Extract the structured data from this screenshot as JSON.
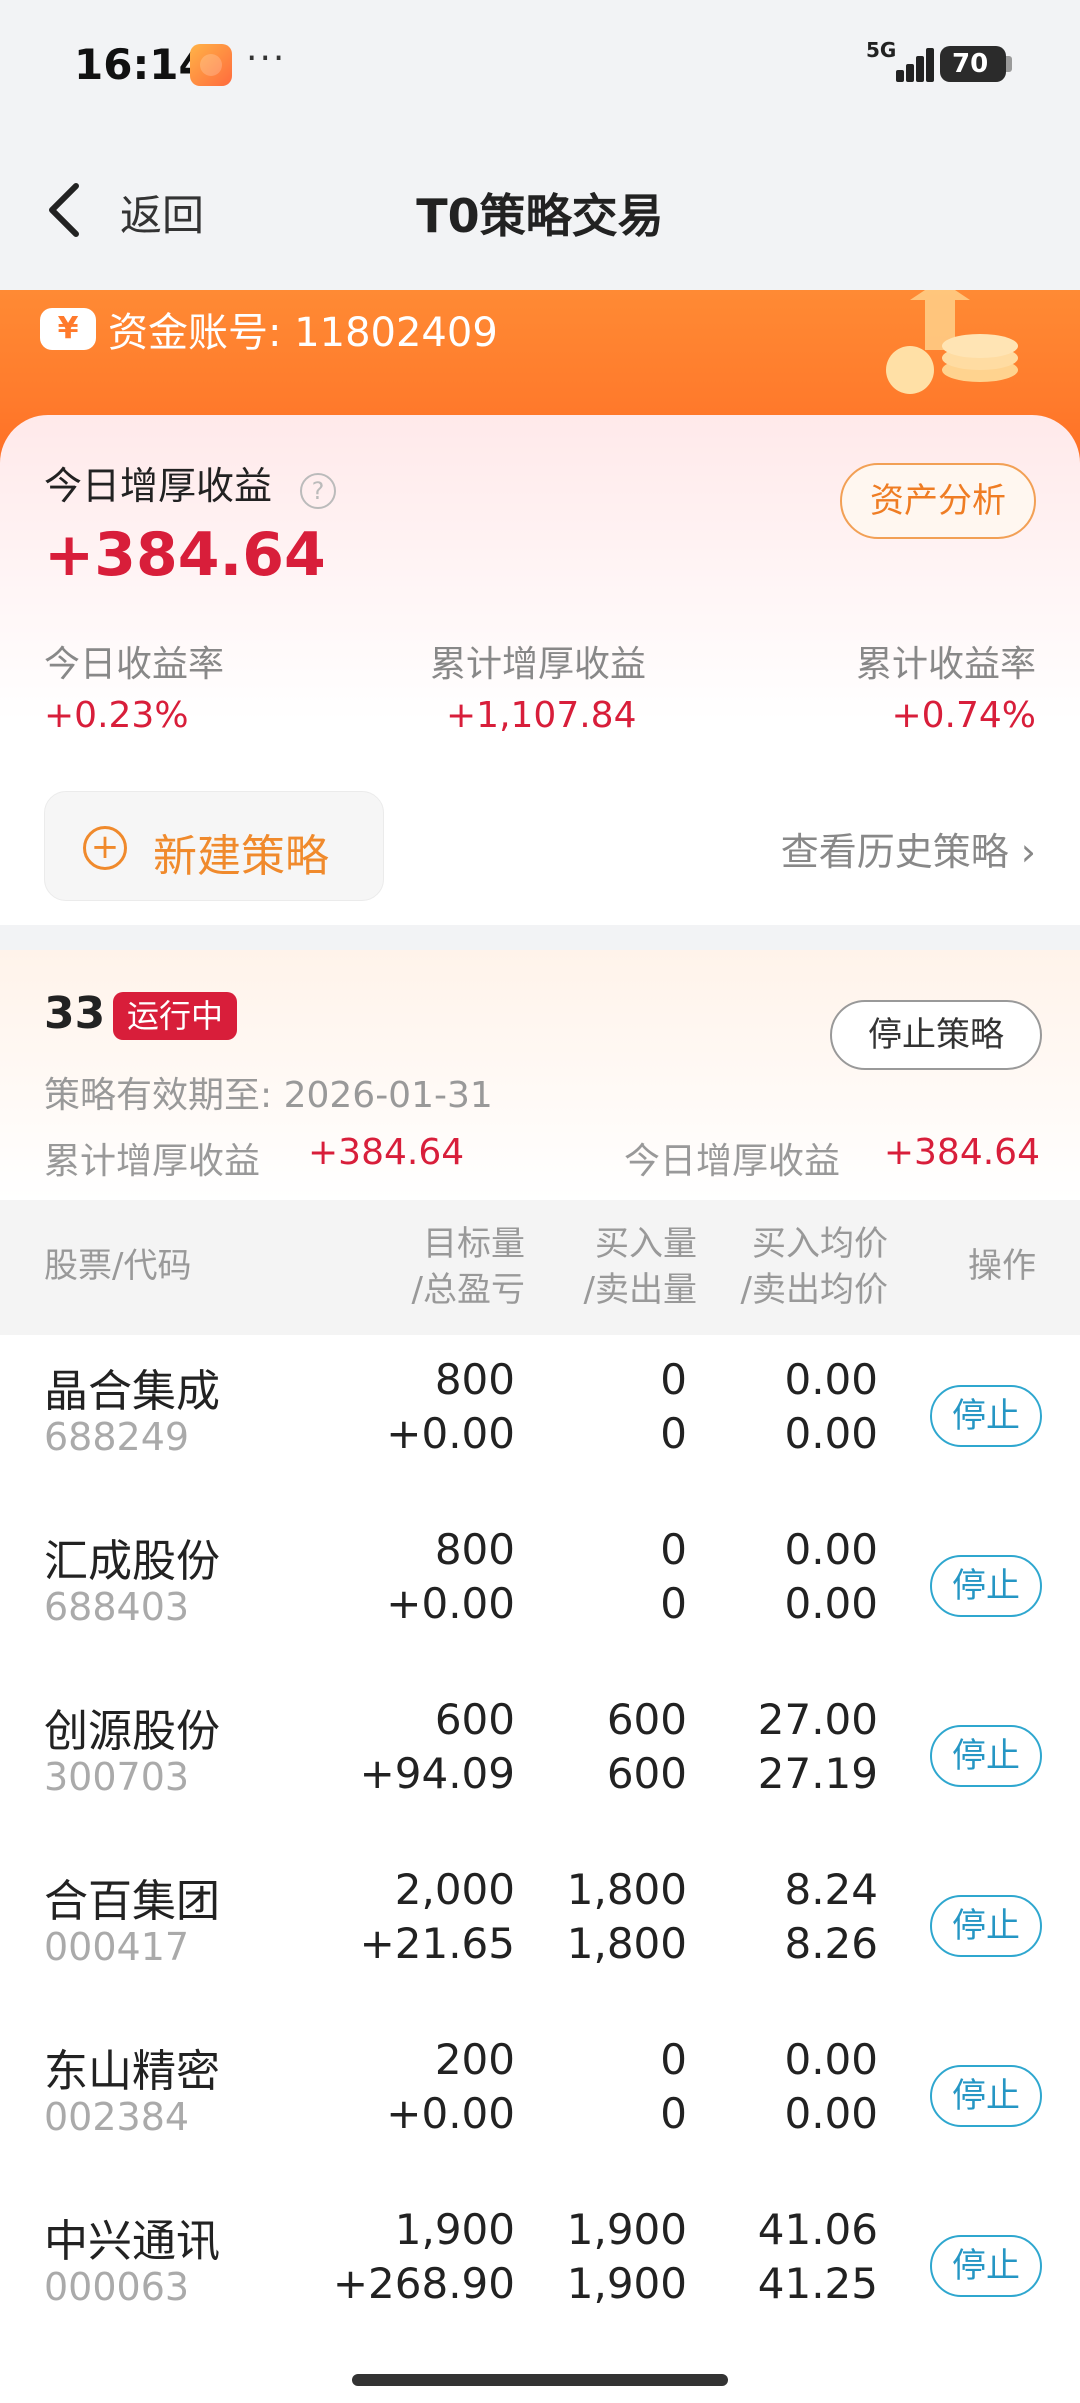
{
  "status": {
    "time": "16:14",
    "more": "···",
    "network": "5G",
    "battery": "70"
  },
  "nav": {
    "back_label": "返回",
    "title": "T0策略交易"
  },
  "banner": {
    "account": "资金账号: 11802409"
  },
  "summary": {
    "today_label": "今日增厚收益",
    "today_value": "+384.64",
    "analysis_button": "资产分析",
    "stats": [
      {
        "label": "今日收益率",
        "value": "+0.23%"
      },
      {
        "label": "累计增厚收益",
        "value": "+1,107.84"
      },
      {
        "label": "累计收益率",
        "value": "+0.74%"
      }
    ],
    "new_strategy": "新建策略",
    "history": "查看历史策略"
  },
  "strategy": {
    "name": "33",
    "status": "运行中",
    "stop_button": "停止策略",
    "valid_until": "策略有效期至: 2026-01-31",
    "cum_label": "累计增厚收益",
    "cum_value": "+384.64",
    "today_label": "今日增厚收益",
    "today_value": "+384.64"
  },
  "table": {
    "headers": {
      "stock": "股票/代码",
      "target_1": "目标量",
      "target_2": "/总盈亏",
      "vol_1": "买入量",
      "vol_2": "/卖出量",
      "price_1": "买入均价",
      "price_2": "/卖出均价",
      "action": "操作"
    },
    "stop_label": "停止",
    "rows": [
      {
        "name": "晶合集成",
        "code": "688249",
        "target": "800",
        "pnl": "+0.00",
        "buy_qty": "0",
        "sell_qty": "0",
        "buy_price": "0.00",
        "sell_price": "0.00"
      },
      {
        "name": "汇成股份",
        "code": "688403",
        "target": "800",
        "pnl": "+0.00",
        "buy_qty": "0",
        "sell_qty": "0",
        "buy_price": "0.00",
        "sell_price": "0.00"
      },
      {
        "name": "创源股份",
        "code": "300703",
        "target": "600",
        "pnl": "+94.09",
        "buy_qty": "600",
        "sell_qty": "600",
        "buy_price": "27.00",
        "sell_price": "27.19"
      },
      {
        "name": "合百集团",
        "code": "000417",
        "target": "2,000",
        "pnl": "+21.65",
        "buy_qty": "1,800",
        "sell_qty": "1,800",
        "buy_price": "8.24",
        "sell_price": "8.26"
      },
      {
        "name": "东山精密",
        "code": "002384",
        "target": "200",
        "pnl": "+0.00",
        "buy_qty": "0",
        "sell_qty": "0",
        "buy_price": "0.00",
        "sell_price": "0.00"
      },
      {
        "name": "中兴通讯",
        "code": "000063",
        "target": "1,900",
        "pnl": "+268.90",
        "buy_qty": "1,900",
        "sell_qty": "1,900",
        "buy_price": "41.06",
        "sell_price": "41.25"
      }
    ]
  },
  "colors": {
    "accent_orange": "#ff7b2c",
    "positive_red": "#d81e3a",
    "stop_blue": "#2596c4"
  }
}
